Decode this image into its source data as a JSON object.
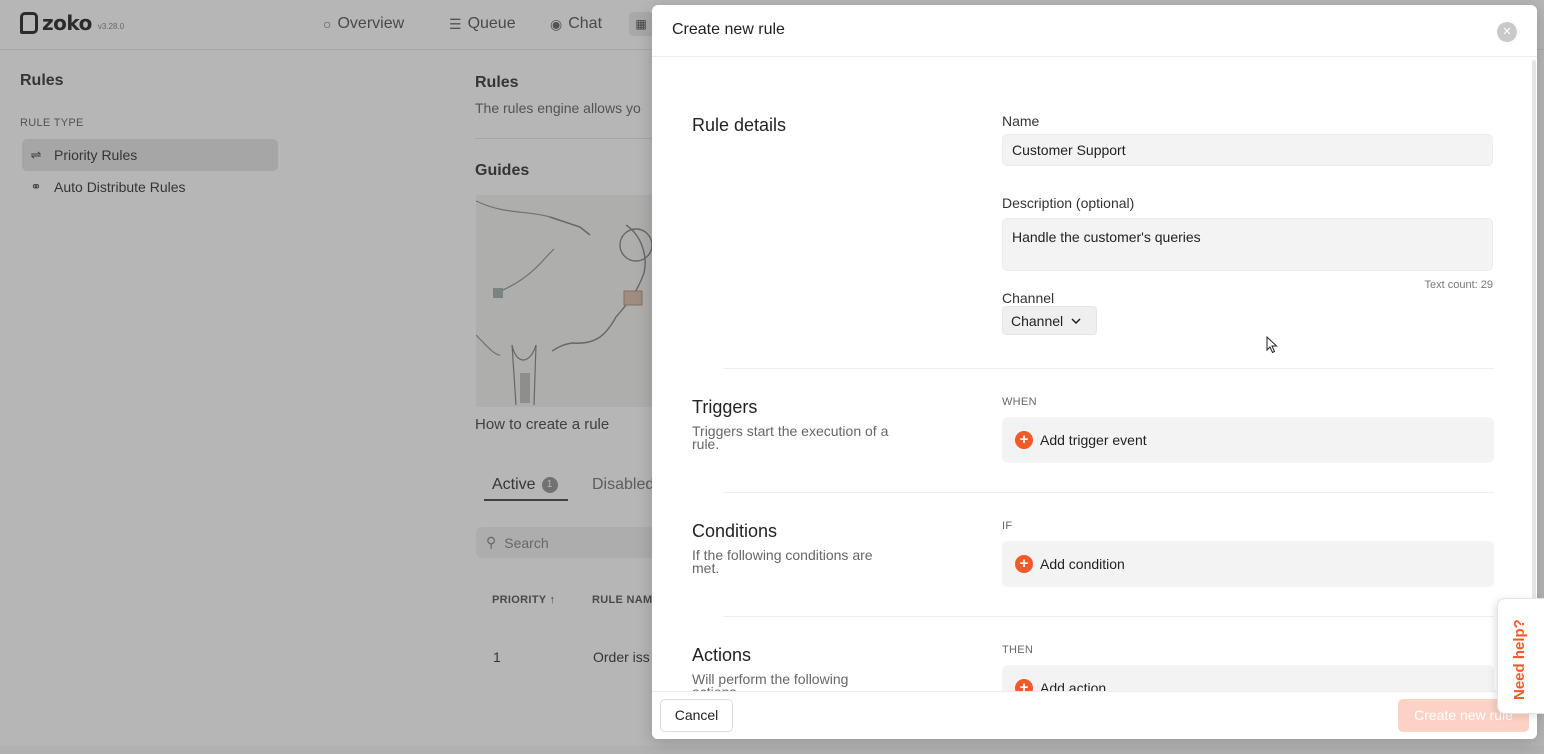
{
  "app": {
    "logo": "zoko",
    "version": "v3.28.0",
    "nav": [
      {
        "label": "Overview",
        "icon": "circle-icon"
      },
      {
        "label": "Queue",
        "icon": "list-icon"
      },
      {
        "label": "Chat",
        "icon": "chat-icon"
      }
    ]
  },
  "sidebar": {
    "title": "Rules",
    "section_label": "RULE TYPE",
    "items": [
      {
        "label": "Priority Rules",
        "icon": "sliders-icon",
        "active": true
      },
      {
        "label": "Auto Distribute Rules",
        "icon": "share-icon",
        "active": false
      }
    ]
  },
  "main": {
    "title": "Rules",
    "description": "The rules engine allows yo",
    "guides_title": "Guides",
    "guide_caption": "How to create a rule",
    "tabs": [
      {
        "label": "Active",
        "badge": "1"
      },
      {
        "label": "Disabled"
      }
    ],
    "search_placeholder": "Search",
    "table": {
      "headers": [
        "PRIORITY ↑",
        "RULE NAM"
      ],
      "rows": [
        [
          "1",
          "Order iss"
        ]
      ]
    }
  },
  "modal": {
    "title": "Create new rule",
    "rule_details": {
      "title": "Rule details",
      "name_label": "Name",
      "name_value": "Customer Support",
      "description_label": "Description (optional)",
      "description_value": "Handle the customer's queries",
      "text_count": "Text count: 29",
      "channel_label": "Channel",
      "channel_value": "Channel"
    },
    "triggers": {
      "title": "Triggers",
      "description": "Triggers start the execution of a rule.",
      "keyword": "WHEN",
      "add_label": "Add trigger event"
    },
    "conditions": {
      "title": "Conditions",
      "description": "If the following conditions are met.",
      "keyword": "IF",
      "add_label": "Add condition"
    },
    "actions": {
      "title": "Actions",
      "description": "Will perform the following actions",
      "keyword": "THEN",
      "add_label": "Add action"
    },
    "footer": {
      "cancel_label": "Cancel",
      "create_label": "Create new rule"
    }
  },
  "help": {
    "label": "Need help?"
  },
  "colors": {
    "accent": "#f25a2a",
    "create_disabled": "#fbd2c4"
  }
}
